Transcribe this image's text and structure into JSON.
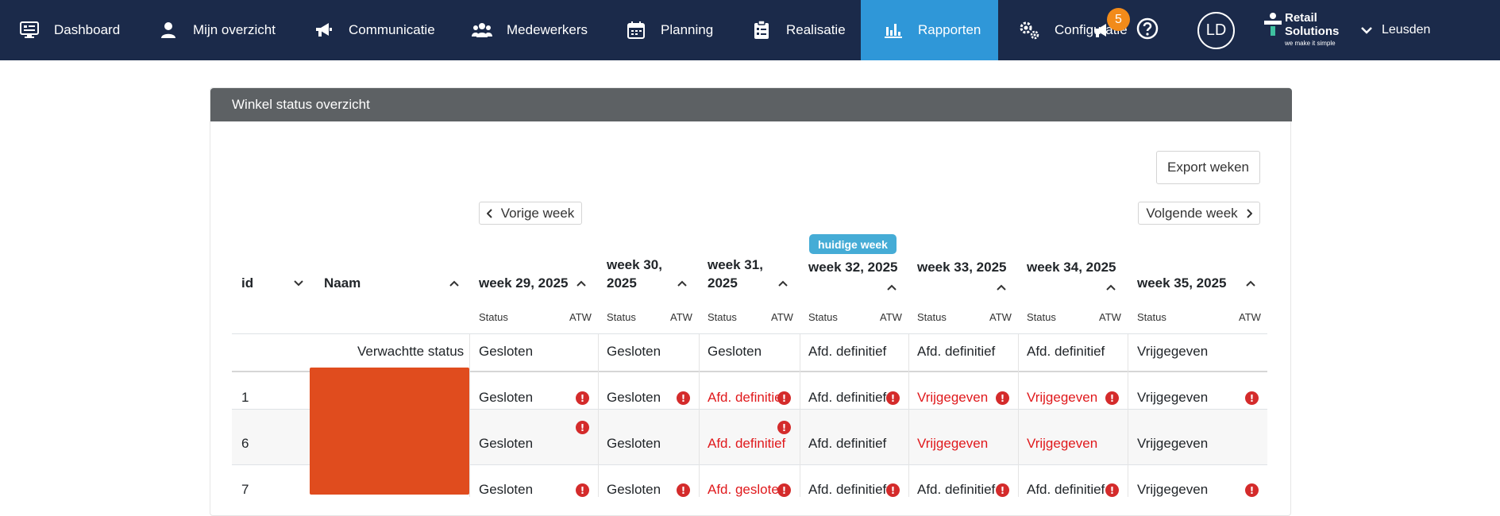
{
  "nav": {
    "items": [
      {
        "label": "Dashboard",
        "icon": "monitor-icon"
      },
      {
        "label": "Mijn overzicht",
        "icon": "person-icon"
      },
      {
        "label": "Communicatie",
        "icon": "megaphone-icon"
      },
      {
        "label": "Medewerkers",
        "icon": "users-icon"
      },
      {
        "label": "Planning",
        "icon": "calendar-icon"
      },
      {
        "label": "Realisatie",
        "icon": "clipboard-icon"
      },
      {
        "label": "Rapporten",
        "icon": "bar-chart-icon",
        "active": true
      },
      {
        "label": "Configuratie",
        "icon": "gears-icon"
      }
    ],
    "notification_count": "5",
    "avatar_initials": "LD",
    "brand": {
      "line1": "Retail",
      "line2": "Solutions",
      "tagline": "we make it simple"
    },
    "store": "Leusden"
  },
  "card": {
    "title": "Winkel status overzicht",
    "export_label": "Export weken",
    "prev_label": "Vorige week",
    "next_label": "Volgende week",
    "current_week_badge": "huidige week"
  },
  "table": {
    "col_id": "id",
    "col_name": "Naam",
    "status_label": "Status",
    "atw_label": "ATW",
    "weeks": [
      {
        "line1": "week 29, 2025",
        "line2": ""
      },
      {
        "line1": "week 30,",
        "line2": "2025"
      },
      {
        "line1": "week 31,",
        "line2": "2025"
      },
      {
        "line1": "week 32, 2025",
        "line2": ""
      },
      {
        "line1": "week 33, 2025",
        "line2": ""
      },
      {
        "line1": "week 34, 2025",
        "line2": ""
      },
      {
        "line1": "week 35, 2025",
        "line2": ""
      }
    ],
    "expected_label": "Verwachtte status",
    "expected": [
      "Gesloten",
      "Gesloten",
      "Gesloten",
      "Afd. definitief",
      "Afd. definitief",
      "Afd. definitief",
      "Vrijgegeven"
    ],
    "rows": [
      {
        "id": "1",
        "cells": [
          {
            "text": "Gesloten",
            "red": false,
            "err": true
          },
          {
            "text": "Gesloten",
            "red": false,
            "err": true
          },
          {
            "text": "Afd. definitief",
            "red": true,
            "err": true
          },
          {
            "text": "Afd. definitief",
            "red": false,
            "err": true
          },
          {
            "text": "Vrijgegeven",
            "red": true,
            "err": true
          },
          {
            "text": "Vrijgegeven",
            "red": true,
            "err": true
          },
          {
            "text": "Vrijgegeven",
            "red": false,
            "err": true
          }
        ]
      },
      {
        "id": "6",
        "cells": [
          {
            "text": "Gesloten",
            "red": false,
            "err": true
          },
          {
            "text": "Gesloten",
            "red": false,
            "err": false
          },
          {
            "text": "Afd. definitief",
            "red": true,
            "err": true
          },
          {
            "text": "Afd. definitief",
            "red": false,
            "err": false
          },
          {
            "text": "Vrijgegeven",
            "red": true,
            "err": false
          },
          {
            "text": "Vrijgegeven",
            "red": true,
            "err": false
          },
          {
            "text": "Vrijgegeven",
            "red": false,
            "err": false
          }
        ]
      },
      {
        "id": "7",
        "cells": [
          {
            "text": "Gesloten",
            "red": false,
            "err": true
          },
          {
            "text": "Gesloten",
            "red": false,
            "err": true
          },
          {
            "text": "Afd. gesloten",
            "red": true,
            "err": true
          },
          {
            "text": "Afd. definitief",
            "red": false,
            "err": true
          },
          {
            "text": "Afd. definitief",
            "red": false,
            "err": true
          },
          {
            "text": "Afd. definitief",
            "red": false,
            "err": true
          },
          {
            "text": "Vrijgegeven",
            "red": false,
            "err": true
          }
        ]
      }
    ],
    "error_glyph": "!"
  }
}
